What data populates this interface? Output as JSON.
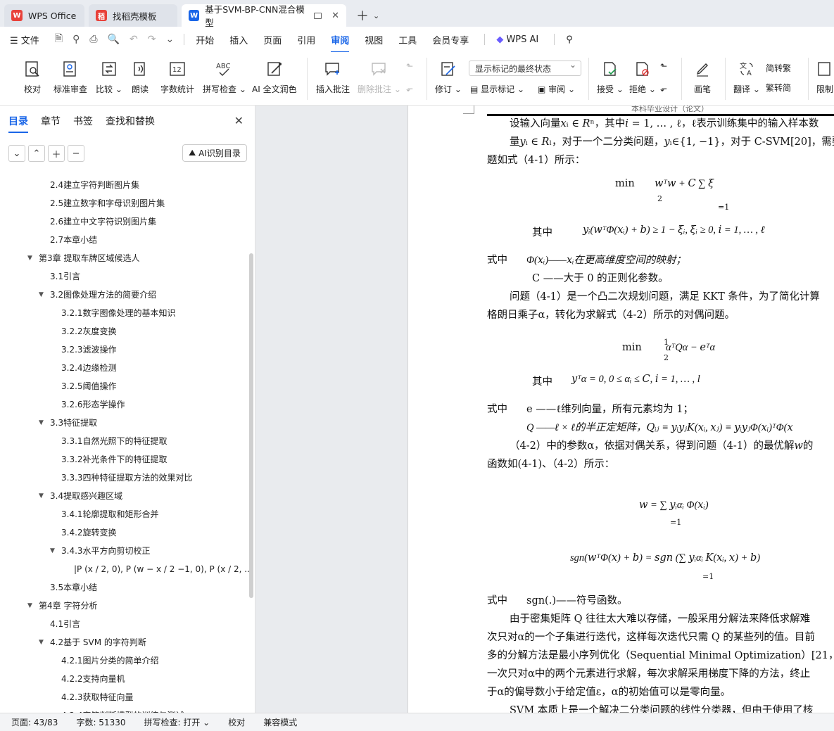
{
  "tabs": [
    {
      "label": "WPS Office",
      "logo_color": "#e8413a"
    },
    {
      "label": "找稻壳模板",
      "logo_color": "#e8413a"
    },
    {
      "label": "基于SVM-BP-CNN混合模型",
      "logo_color": "#1a66e8"
    }
  ],
  "menu": {
    "file": "文件",
    "items": [
      "开始",
      "插入",
      "页面",
      "引用",
      "审阅",
      "视图",
      "工具",
      "会员专享"
    ],
    "selected": "审阅",
    "wps_ai": "WPS AI"
  },
  "ribbon": {
    "proofread": "校对",
    "standard_review": "标准审查",
    "compare": "比较",
    "read_aloud": "朗读",
    "word_count": "字数统计",
    "spell_check": "拼写检查",
    "ai_polish": "AI 全文润色",
    "insert_comment": "插入批注",
    "delete_comment": "删除批注",
    "track_changes": "修订",
    "markup_select": "显示标记的最终状态",
    "show_markup": "显示标记",
    "review": "审阅",
    "accept": "接受",
    "reject": "拒绝",
    "pen": "画笔",
    "translate": "翻译",
    "trad_convert": "转繁",
    "simp_convert": "转简",
    "restrict": "限制"
  },
  "sidebar": {
    "tabs": [
      "目录",
      "章节",
      "书签",
      "查找和替换"
    ],
    "ai_toc": "AI识别目录",
    "toc": [
      {
        "label": "2.4建立字符判断图片集",
        "level": 2,
        "caret": ""
      },
      {
        "label": "2.5建立数字和字母识别图片集",
        "level": 2,
        "caret": ""
      },
      {
        "label": "2.6建立中文字符识别图片集",
        "level": 2,
        "caret": ""
      },
      {
        "label": "2.7本章小结",
        "level": 2,
        "caret": ""
      },
      {
        "label": "第3章 提取车牌区域候选人",
        "level": 1,
        "caret": "▼"
      },
      {
        "label": "3.1引言",
        "level": 2,
        "caret": ""
      },
      {
        "label": "3.2图像处理方法的简要介绍",
        "level": 2,
        "caret": "▼"
      },
      {
        "label": "3.2.1数字图像处理的基本知识",
        "level": 3,
        "caret": ""
      },
      {
        "label": "3.2.2灰度变换",
        "level": 3,
        "caret": ""
      },
      {
        "label": "3.2.3滤波操作",
        "level": 3,
        "caret": ""
      },
      {
        "label": "3.2.4边缘检测",
        "level": 3,
        "caret": ""
      },
      {
        "label": "3.2.5阈值操作",
        "level": 3,
        "caret": ""
      },
      {
        "label": "3.2.6形态学操作",
        "level": 3,
        "caret": ""
      },
      {
        "label": "3.3特征提取",
        "level": 2,
        "caret": "▼"
      },
      {
        "label": "3.3.1自然光照下的特征提取",
        "level": 3,
        "caret": ""
      },
      {
        "label": "3.3.2补光条件下的特征提取",
        "level": 3,
        "caret": ""
      },
      {
        "label": "3.3.3四种特征提取方法的效果对比",
        "level": 3,
        "caret": ""
      },
      {
        "label": "3.4提取感兴趣区域",
        "level": 2,
        "caret": "▼"
      },
      {
        "label": "3.4.1轮廓提取和矩形合并",
        "level": 3,
        "caret": ""
      },
      {
        "label": "3.4.2旋转变换",
        "level": 3,
        "caret": ""
      },
      {
        "label": "3.4.3水平方向剪切校正",
        "level": 3,
        "caret": "▼"
      },
      {
        "label": "|P (x / 2, 0), P (w − x / 2 −1, 0), P (x / 2, ...",
        "level": 4,
        "caret": ""
      },
      {
        "label": "3.5本章小结",
        "level": 2,
        "caret": ""
      },
      {
        "label": "第4章 字符分析",
        "level": 1,
        "caret": "▼"
      },
      {
        "label": "4.1引言",
        "level": 2,
        "caret": ""
      },
      {
        "label": "4.2基于 SVM 的字符判断",
        "level": 2,
        "caret": "▼"
      },
      {
        "label": "4.2.1图片分类的简单介绍",
        "level": 3,
        "caret": ""
      },
      {
        "label": "4.2.2支持向量机",
        "level": 3,
        "caret": ""
      },
      {
        "label": "4.2.3获取特征向量",
        "level": 3,
        "caret": ""
      },
      {
        "label": "4.2.4字符判断模型的训练与测试",
        "level": 3,
        "caret": ""
      }
    ]
  },
  "doc": {
    "header": "本科毕业设计（论文）",
    "lines": [
      "设输入向量𝑥ᵢ ∈ 𝑅ⁿ，其中𝑖 = 1, … , ℓ，ℓ表示训练集中的输入样本数",
      "量𝑦ᵢ ∈ 𝑅ₗ，对于一个二分类问题，𝑦ᵢ∈{1, −1}，对于 C-SVM[20]，需要优",
      "题如式（4-1）所示：",
      "min",
      "𝑤ᵀ𝑤 + 𝐶 ∑ 𝜉",
      "其中",
      "𝑦ᵢ(𝑤ᵀΦ(𝑥ᵢ) + 𝑏) ≥ 1 − 𝜉ᵢ,     𝜉ᵢ ≥ 0,     𝑖 = 1, … , ℓ",
      "式中",
      "Φ(𝑥ᵢ)——𝑥ᵢ在更高维度空间的映射；",
      "C ——大于 0 的正则化参数。",
      "问题（4-1）是一个凸二次规划问题，满足 KKT 条件，为了简化计算",
      "格朗日乘子α，转化为求解式（4-2）所示的对偶问题。",
      "min",
      "αᵀQα − 𝑒ᵀα",
      "其中",
      "𝑦ᵀα = 0,     0 ≤ αᵢ ≤ 𝐶,     𝑖 = 1, … , l",
      "式中",
      "e ——ℓ维列向量，所有元素均为 1；",
      "Q ——ℓ × ℓ的半正定矩阵，𝑄ᵢⱼ ≡ 𝑦ᵢ𝑦ⱼ𝐾(𝑥ᵢ, 𝑥ⱼ) ≡ 𝑦ᵢ𝑦ⱼΦ(𝑥ᵢ)ᵀΦ(𝑥",
      "（4-2）中的参数α，依据对偶关系，得到问题（4-1）的最优解𝑤的",
      "函数如(4-1)、（4-2）所示：",
      "𝑤 = ∑ 𝑦ᵢαᵢ Φ(𝑥ᵢ)",
      "sgn(𝑤ᵀΦ(𝑥) + 𝑏) = 𝑠𝑔𝑛 (∑ 𝑦ᵢαᵢ 𝐾(𝑥ᵢ, 𝑥) + 𝑏)",
      "式中",
      "sgn(.)——符号函数。",
      "由于密集矩阵 Q 往往太大难以存储，一般采用分解法来降低求解难",
      "次只对α的一个子集进行迭代，这样每次迭代只需 Q 的某些列的值。目前",
      "多的分解方法是最小序列优化（Sequential Minimal Optimization）[21，22",
      "一次只对α中的两个元素进行求解，每次求解采用梯度下降的方法，终止",
      "于α的偏导数小于给定值ε，α的初始值可以是零向量。",
      "SVM 本质上是一个解决二分类问题的线性分类器，但由于使用了核"
    ],
    "frac_1_2_num": "1",
    "frac_1_2_den": "2",
    "sum_sub": "=1"
  },
  "status": {
    "page": "页面: 43/83",
    "words": "字数: 51330",
    "spell": "拼写检查: 打开",
    "proof": "校对",
    "compat": "兼容模式"
  }
}
